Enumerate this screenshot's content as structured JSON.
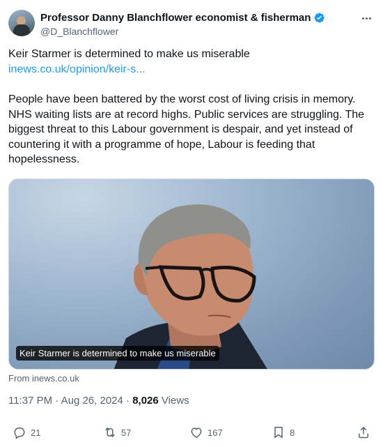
{
  "author": {
    "display_name": "Professor Danny Blanchflower economist & fisherman",
    "handle": "@D_Blanchflower",
    "verified": true
  },
  "tweet": {
    "headline": "Keir Starmer is determined to make us miserable",
    "link_text": "inews.co.uk/opinion/keir-s...",
    "body": "People have been battered by the worst cost of living crisis in memory. NHS waiting lists are at record highs. Public services are struggling. The biggest threat to this Labour government is despair, and yet instead of countering it with a programme of hope, Labour is feeding that hopelessness."
  },
  "card": {
    "caption": "Keir Starmer is determined to make us miserable",
    "source": "From inews.co.uk"
  },
  "meta": {
    "time": "11:37 PM",
    "separator": "·",
    "date": "Aug 26, 2024",
    "views_count": "8,026",
    "views_label": "Views"
  },
  "actions": {
    "replies": "21",
    "reposts": "57",
    "likes": "167",
    "bookmarks": "8"
  },
  "colors": {
    "accent": "#1d9bf0",
    "text": "#0f1419",
    "muted": "#536471"
  },
  "icons": [
    "verified-badge-icon",
    "more-icon",
    "reply-icon",
    "repost-icon",
    "like-icon",
    "bookmark-icon",
    "share-icon"
  ]
}
